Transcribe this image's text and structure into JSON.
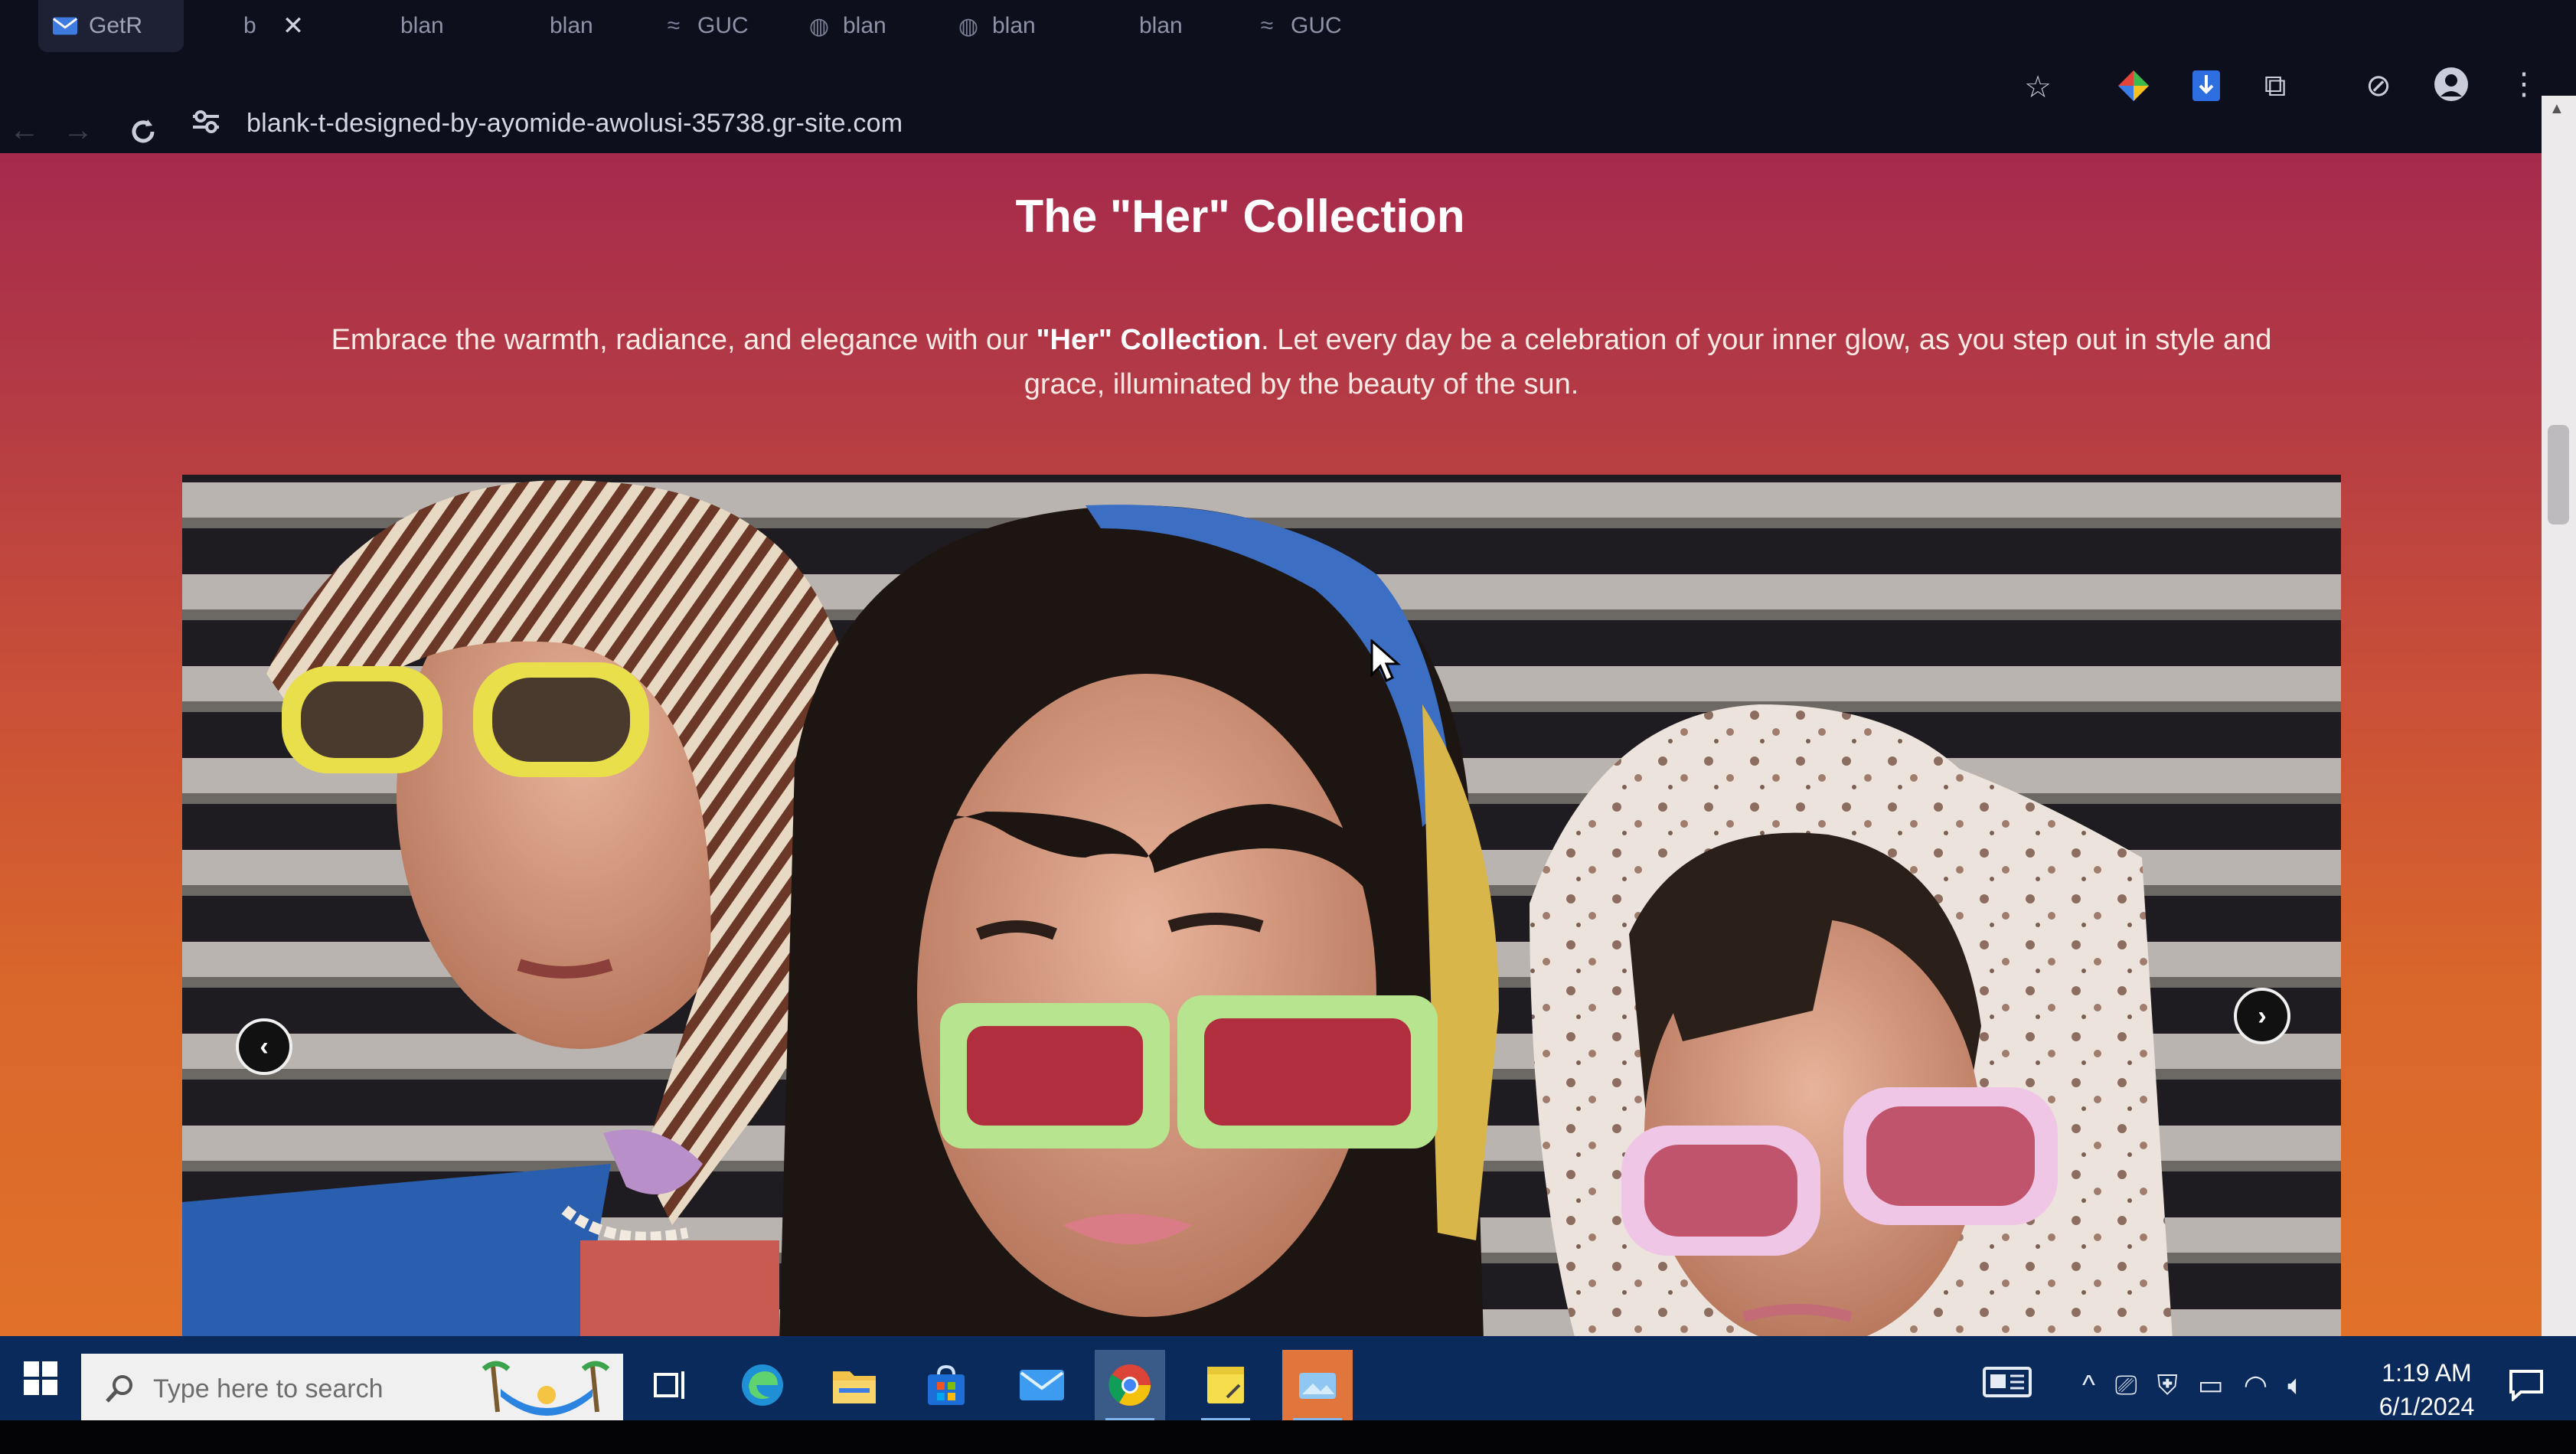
{
  "browser": {
    "tabs": [
      {
        "label": "GetR",
        "icon": "mail-icon",
        "active": true
      },
      {
        "label": "b",
        "icon": "",
        "active": false
      },
      {
        "label": "blan",
        "icon": "",
        "active": false
      },
      {
        "label": "blan",
        "icon": "",
        "active": false
      },
      {
        "label": "GUC",
        "icon": "wave-icon",
        "active": false
      },
      {
        "label": "blan",
        "icon": "globe-icon",
        "active": false
      },
      {
        "label": "blan",
        "icon": "globe-icon",
        "active": false
      },
      {
        "label": "blan",
        "icon": "",
        "active": false
      },
      {
        "label": "GUC",
        "icon": "wave-icon",
        "active": false
      }
    ],
    "url": "blank-t-designed-by-ayomide-awolusi-35738.gr-site.com"
  },
  "page": {
    "title": "The \"Her\" Collection",
    "description_before": "Embrace the warmth, radiance, and elegance with our ",
    "description_bold": "\"Her\" Collection",
    "description_after": ". Let every day be a celebration of your inner glow, as you step out in style and grace, illuminated by the beauty of the sun.",
    "slider": {
      "prev_label": "‹",
      "next_label": "›"
    }
  },
  "taskbar": {
    "search_placeholder": "Type here to search",
    "time": "1:19 AM",
    "date": "6/1/2024"
  },
  "colors": {
    "page_gradient_top": "#a62a4c",
    "page_gradient_bottom": "#e0712a",
    "taskbar": "#0a2a5c"
  }
}
